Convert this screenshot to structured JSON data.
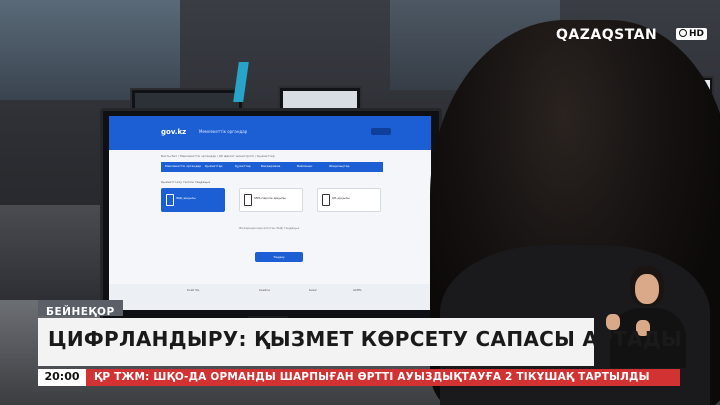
{
  "channel": {
    "logo_text": "QAZAQSTAN",
    "hd_badge": "HD"
  },
  "monitor": {
    "site_logo": "gov.kz",
    "nav_title": "Мемлекеттік органдар",
    "breadcrumbs": "Басты бет / Мемлекеттік органдар / ҚР Әділет министрлігі / Қызметтер",
    "menu_items": [
      "Мемлекеттік органдар",
      "Қызметтер",
      "Құжаттар",
      "Бағдарлама",
      "Байланыс",
      "Жаңалықтар"
    ],
    "description": "Қызметті алу тәсілін таңдаңыз",
    "cards": [
      {
        "label": "ЭЦҚ арқылы",
        "active": true
      },
      {
        "label": "SMS-пароль арқылы",
        "active": false
      },
      {
        "label": "QR арқылы",
        "active": false
      }
    ],
    "message": "Жоғарыда көрсетілген ЭЦҚ таңдаңыз",
    "button_label": "Таңдау",
    "footer_items": [
      "Kcell 5G",
      "beeline",
      "tele2",
      "ALTEL"
    ]
  },
  "lower_third": {
    "location_tag": "БЕЙНЕҚОР",
    "headline": "ЦИФРЛАНДЫРУ: ҚЫЗМЕТ КӨРСЕТУ САПАСЫ АРТАДЫ",
    "time": "20:00",
    "ticker": "ҚР ТЖМ: ШҚО-ДА ОРМАНДЫ ШАРПЫҒАН ӨРТТІ АУЫЗДЫҚТАУҒА 2 ТІКҰШАҚ ТАРТЫЛДЫ"
  },
  "colors": {
    "gov_blue": "#1c5fd4",
    "ticker_red": "#d23232",
    "headline_bg": "#f3f3f3",
    "tag_bg": "#5b6068"
  }
}
